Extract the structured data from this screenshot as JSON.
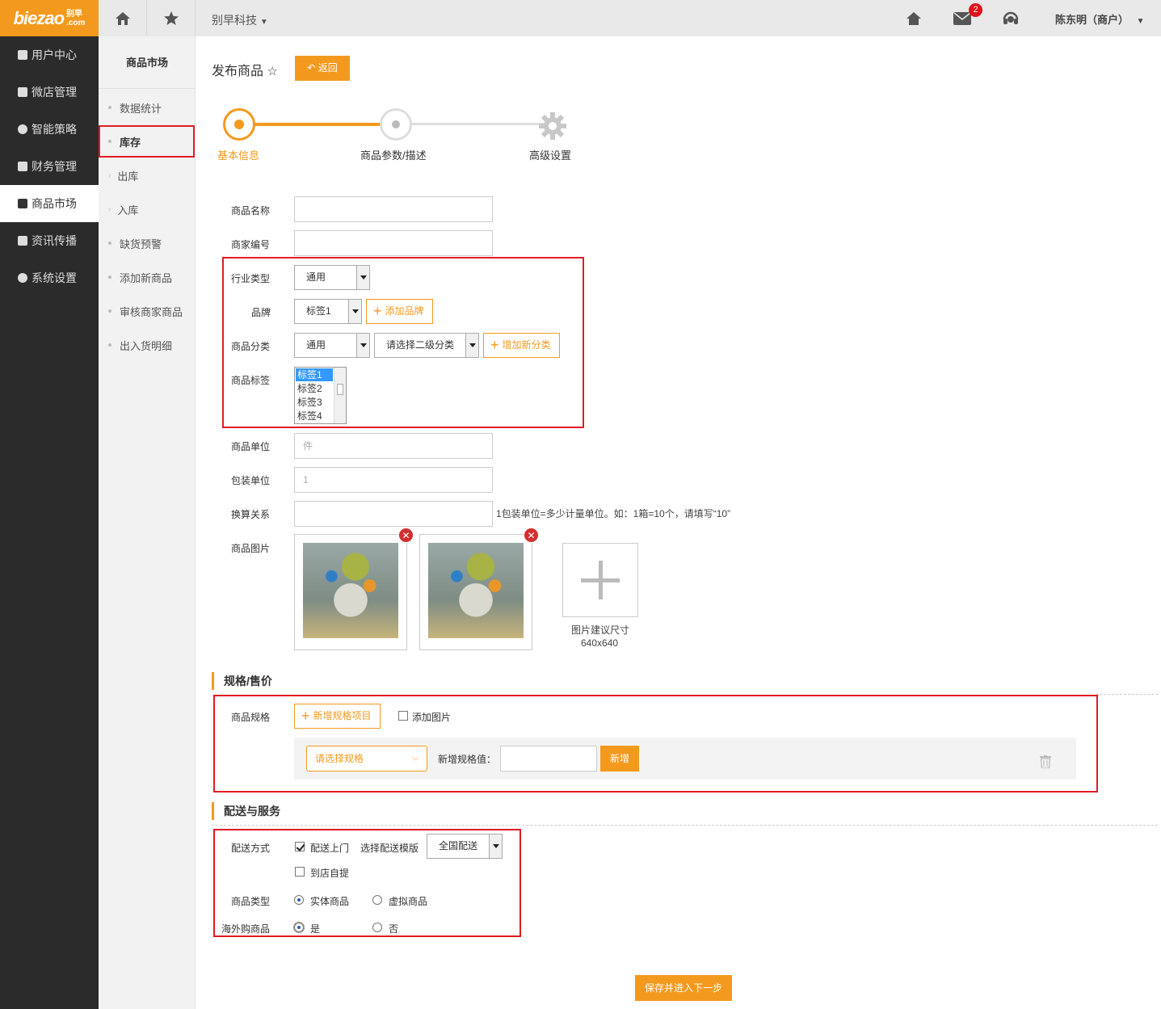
{
  "header": {
    "logo_text": "biezao",
    "logo_cn": "别早",
    "logo_com": ".com",
    "company": "别早科技",
    "mail_count": "2",
    "user": "陈东明（商户）"
  },
  "sidebar": {
    "items": [
      {
        "label": "用户中心"
      },
      {
        "label": "微店管理"
      },
      {
        "label": "智能策略"
      },
      {
        "label": "财务管理"
      },
      {
        "label": "商品市场"
      },
      {
        "label": "资讯传播"
      },
      {
        "label": "系统设置"
      }
    ]
  },
  "subnav": {
    "title": "商品市场",
    "items": [
      {
        "label": "数据统计"
      },
      {
        "label": "库存"
      },
      {
        "label": "出库"
      },
      {
        "label": "入库"
      },
      {
        "label": "缺货预警"
      },
      {
        "label": "添加新商品"
      },
      {
        "label": "审核商家商品"
      },
      {
        "label": "出入货明细"
      }
    ]
  },
  "page": {
    "title": "发布商品",
    "back_label": "返回"
  },
  "steps": [
    "基本信息",
    "商品参数/描述",
    "高级设置"
  ],
  "form": {
    "name_label": "商品名称",
    "code_label": "商家编号",
    "industry_label": "行业类型",
    "industry_value": "通用",
    "brand_label": "品牌",
    "brand_value": "标签1",
    "add_brand": "添加品牌",
    "category_label": "商品分类",
    "category_value": "通用",
    "category2_value": "请选择二级分类",
    "add_category": "增加新分类",
    "tags_label": "商品标签",
    "tags": [
      "标签1",
      "标签2",
      "标签3",
      "标签4"
    ],
    "unit_label": "商品单位",
    "unit_placeholder": "件",
    "pack_label": "包装单位",
    "pack_placeholder": "1",
    "convert_label": "换算关系",
    "convert_hint": "1包装单位=多少计量单位。如：1箱=10个，请填写“10”",
    "image_label": "商品图片",
    "image_hint1": "图片建议尺寸",
    "image_hint2": "640x640"
  },
  "spec": {
    "section_title": "规格/售价",
    "label": "商品规格",
    "add_item": "新增规格项目",
    "add_image": "添加图片",
    "select_placeholder": "请选择规格",
    "value_label": "新增规格值：",
    "add_button": "新增"
  },
  "delivery": {
    "section_title": "配送与服务",
    "method_label": "配送方式",
    "door": "配送上门",
    "template_label": "选择配送模版",
    "template_value": "全国配送",
    "pickup": "到店自提",
    "type_label": "商品类型",
    "physical": "实体商品",
    "virtual": "虚拟商品",
    "overseas_label": "海外购商品",
    "yes": "是",
    "no": "否"
  },
  "footer": {
    "save_next": "保存并进入下一步"
  },
  "colors": {
    "accent": "#f39a1e",
    "sidebar_bg": "#2b2b2b",
    "highlight_border": "#e21b23"
  }
}
